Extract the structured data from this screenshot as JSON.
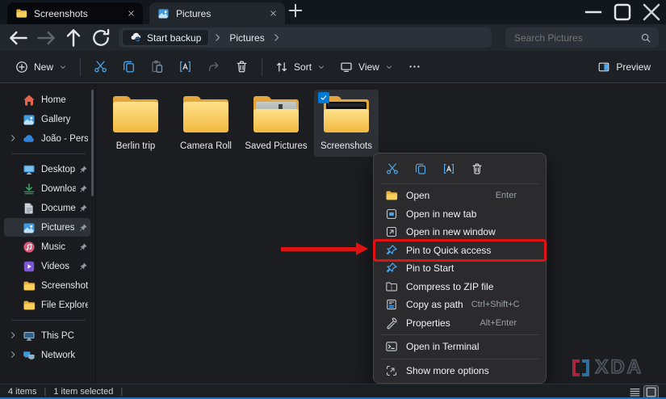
{
  "window": {
    "tabs": [
      {
        "label": "Screenshots",
        "icon": "folder-icon",
        "active": false
      },
      {
        "label": "Pictures",
        "icon": "pictures-icon",
        "active": true
      }
    ],
    "new_tab_icon": "plus-icon",
    "controls": [
      {
        "name": "minimize",
        "icon": "minimize-icon"
      },
      {
        "name": "maximize",
        "icon": "maximize-icon"
      },
      {
        "name": "close",
        "icon": "close-icon"
      }
    ]
  },
  "navbar": {
    "nav_buttons": [
      {
        "name": "back",
        "icon": "back-icon",
        "enabled": true
      },
      {
        "name": "forward",
        "icon": "forward-icon",
        "enabled": false
      },
      {
        "name": "up",
        "icon": "up-icon",
        "enabled": true
      },
      {
        "name": "refresh",
        "icon": "refresh-icon",
        "enabled": true
      }
    ],
    "breadcrumb": {
      "backup_label": "Start backup",
      "backup_icon": "cloud-sync-icon",
      "location": "Pictures"
    },
    "search": {
      "placeholder": "Search Pictures",
      "icon": "search-icon"
    }
  },
  "toolbar": {
    "new_label": "New",
    "commands": [
      {
        "name": "cut",
        "icon": "cut-icon",
        "enabled": true
      },
      {
        "name": "copy",
        "icon": "copy-icon",
        "enabled": true
      },
      {
        "name": "paste",
        "icon": "paste-icon",
        "enabled": false
      },
      {
        "name": "rename",
        "icon": "rename-icon",
        "enabled": true
      },
      {
        "name": "share",
        "icon": "share-icon",
        "enabled": false
      },
      {
        "name": "delete",
        "icon": "delete-icon",
        "enabled": true
      }
    ],
    "sort_label": "Sort",
    "view_label": "View",
    "preview_label": "Preview"
  },
  "sidebar": {
    "items": [
      {
        "label": "Home",
        "icon": "home-icon",
        "pinned": false,
        "chevron": false,
        "selected": false,
        "separator_after": false
      },
      {
        "label": "Gallery",
        "icon": "gallery-icon",
        "pinned": false,
        "chevron": false,
        "selected": false,
        "separator_after": false
      },
      {
        "label": "João - Personal",
        "icon": "onedrive-icon",
        "pinned": false,
        "chevron": true,
        "selected": false,
        "separator_after": true
      },
      {
        "label": "Desktop",
        "icon": "desktop-icon",
        "pinned": true,
        "chevron": false,
        "selected": false,
        "separator_after": false
      },
      {
        "label": "Downloads",
        "icon": "downloads-icon",
        "pinned": true,
        "chevron": false,
        "selected": false,
        "separator_after": false
      },
      {
        "label": "Documents",
        "icon": "documents-icon",
        "pinned": true,
        "chevron": false,
        "selected": false,
        "separator_after": false
      },
      {
        "label": "Pictures",
        "icon": "pictures-icon",
        "pinned": true,
        "chevron": false,
        "selected": true,
        "separator_after": false
      },
      {
        "label": "Music",
        "icon": "music-icon",
        "pinned": true,
        "chevron": false,
        "selected": false,
        "separator_after": false
      },
      {
        "label": "Videos",
        "icon": "videos-icon",
        "pinned": true,
        "chevron": false,
        "selected": false,
        "separator_after": false
      },
      {
        "label": "Screenshots",
        "icon": "folder-icon",
        "pinned": false,
        "chevron": false,
        "selected": false,
        "separator_after": false
      },
      {
        "label": "File Explorer gui",
        "icon": "folder-icon",
        "pinned": false,
        "chevron": false,
        "selected": false,
        "separator_after": true
      },
      {
        "label": "This PC",
        "icon": "thispc-icon",
        "pinned": false,
        "chevron": true,
        "selected": false,
        "separator_after": false
      },
      {
        "label": "Network",
        "icon": "network-icon",
        "pinned": false,
        "chevron": true,
        "selected": false,
        "separator_after": false
      }
    ]
  },
  "folders": [
    {
      "name": "Berlin trip",
      "thumb": "none",
      "selected": false
    },
    {
      "name": "Camera Roll",
      "thumb": "none",
      "selected": false
    },
    {
      "name": "Saved Pictures",
      "thumb": "photo",
      "selected": false
    },
    {
      "name": "Screenshots",
      "thumb": "screenshot",
      "selected": true
    }
  ],
  "context_menu": {
    "quick_actions": [
      {
        "name": "cut",
        "icon": "cut-icon"
      },
      {
        "name": "copy",
        "icon": "copy-icon"
      },
      {
        "name": "rename",
        "icon": "rename-icon"
      },
      {
        "name": "delete",
        "icon": "delete-icon"
      }
    ],
    "items": [
      {
        "label": "Open",
        "icon": "open-folder-icon",
        "shortcut": "Enter",
        "highlighted": false,
        "separator_after": false
      },
      {
        "label": "Open in new tab",
        "icon": "new-tab-icon",
        "shortcut": "",
        "highlighted": false,
        "separator_after": false
      },
      {
        "label": "Open in new window",
        "icon": "new-window-icon",
        "shortcut": "",
        "highlighted": false,
        "separator_after": false
      },
      {
        "label": "Pin to Quick access",
        "icon": "pin-icon",
        "shortcut": "",
        "highlighted": true,
        "separator_after": false
      },
      {
        "label": "Pin to Start",
        "icon": "pin-icon",
        "shortcut": "",
        "highlighted": false,
        "separator_after": false
      },
      {
        "label": "Compress to ZIP file",
        "icon": "zip-icon",
        "shortcut": "",
        "highlighted": false,
        "separator_after": false
      },
      {
        "label": "Copy as path",
        "icon": "copy-path-icon",
        "shortcut": "Ctrl+Shift+C",
        "highlighted": false,
        "separator_after": false
      },
      {
        "label": "Properties",
        "icon": "properties-icon",
        "shortcut": "Alt+Enter",
        "highlighted": false,
        "separator_after": true
      },
      {
        "label": "Open in Terminal",
        "icon": "terminal-icon",
        "shortcut": "",
        "highlighted": false,
        "separator_after": true
      },
      {
        "label": "Show more options",
        "icon": "more-options-icon",
        "shortcut": "",
        "highlighted": false,
        "separator_after": false
      }
    ]
  },
  "statusbar": {
    "items_count": "4 items",
    "selection": "1 item selected",
    "view_toggles": [
      {
        "name": "details-view",
        "icon": "details-view-icon",
        "active": false
      },
      {
        "name": "large-icons-view",
        "icon": "thumbnails-view-icon",
        "active": true
      }
    ]
  },
  "watermark": {
    "text": "XDA"
  },
  "colors": {
    "accent_blue": "#4da6ea",
    "selection_checkbox": "#0078d4",
    "highlight_red": "#e01212",
    "folder_yellow": "#f1b93f"
  }
}
